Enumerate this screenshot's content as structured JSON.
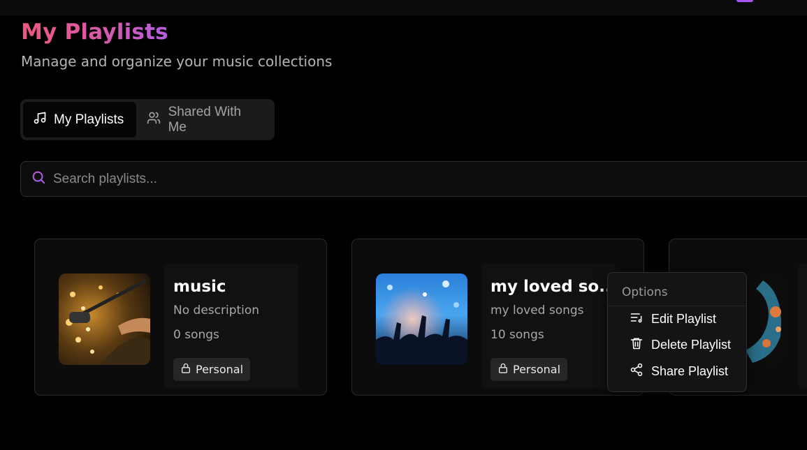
{
  "header": {
    "title": "My Playlists",
    "subtitle": "Manage and organize your music collections"
  },
  "tabs": [
    {
      "label": "My Playlists",
      "icon": "music-note-icon",
      "active": true
    },
    {
      "label": "Shared With Me",
      "icon": "users-icon",
      "active": false
    }
  ],
  "search": {
    "placeholder": "Search playlists...",
    "value": ""
  },
  "playlists": [
    {
      "title": "music",
      "description": "No description",
      "count": "0 songs",
      "badge": "Personal",
      "image": "concert-microphone-lights"
    },
    {
      "title": "my loved so...",
      "description": "my loved songs",
      "count": "10 songs",
      "badge": "Personal",
      "image": "crowd-hands-concert"
    },
    {
      "image": "headphones-splash"
    }
  ],
  "options_menu": {
    "header": "Options",
    "items": [
      {
        "label": "Edit Playlist",
        "icon": "edit-list-icon"
      },
      {
        "label": "Delete Playlist",
        "icon": "trash-icon"
      },
      {
        "label": "Share Playlist",
        "icon": "share-icon"
      }
    ]
  },
  "colors": {
    "accent_gradient_start": "#f0577f",
    "accent_gradient_end": "#b45fe0",
    "background": "#000000",
    "card": "#0c0c0c"
  }
}
